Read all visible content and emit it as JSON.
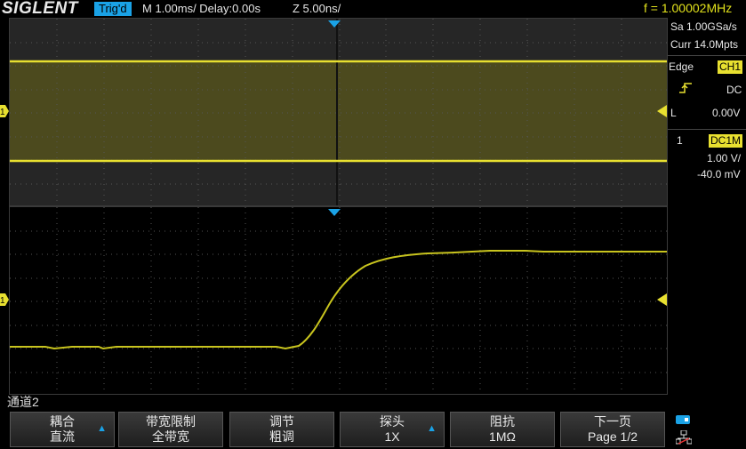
{
  "topbar": {
    "brand": "SIGLENT",
    "trigger_status": "Trig'd",
    "timebase": "M 1.00ms/ Delay:0.00s",
    "zoom_timebase": "Z 5.00ns/",
    "frequency": "f = 1.00002MHz"
  },
  "acquisition": {
    "sample_rate": "Sa 1.00GSa/s",
    "memory_depth": "Curr 14.0Mpts"
  },
  "trigger": {
    "type": "Edge",
    "source": "CH1",
    "slope_icon": "rising-edge-icon",
    "coupling": "DC",
    "mode": "L",
    "level": "0.00V"
  },
  "channel": {
    "number": "1",
    "coupling_impedance": "DC1M",
    "scale": "1.00 V/",
    "offset": "-40.0 mV",
    "color": "#e8e030",
    "marker_label": "1"
  },
  "menu": {
    "title": "通道2",
    "softkeys": [
      {
        "label": "耦合",
        "value": "直流"
      },
      {
        "label": "带宽限制",
        "value": "全带宽"
      },
      {
        "label": "调节",
        "value": "粗调"
      },
      {
        "label": "探头",
        "value": "1X"
      },
      {
        "label": "阻抗",
        "value": "1MΩ"
      },
      {
        "label": "下一页",
        "value": "Page 1/2"
      }
    ]
  },
  "colors": {
    "trace": "#e8e030",
    "accent": "#1aa2e6",
    "grid": "#3a3a3a"
  }
}
